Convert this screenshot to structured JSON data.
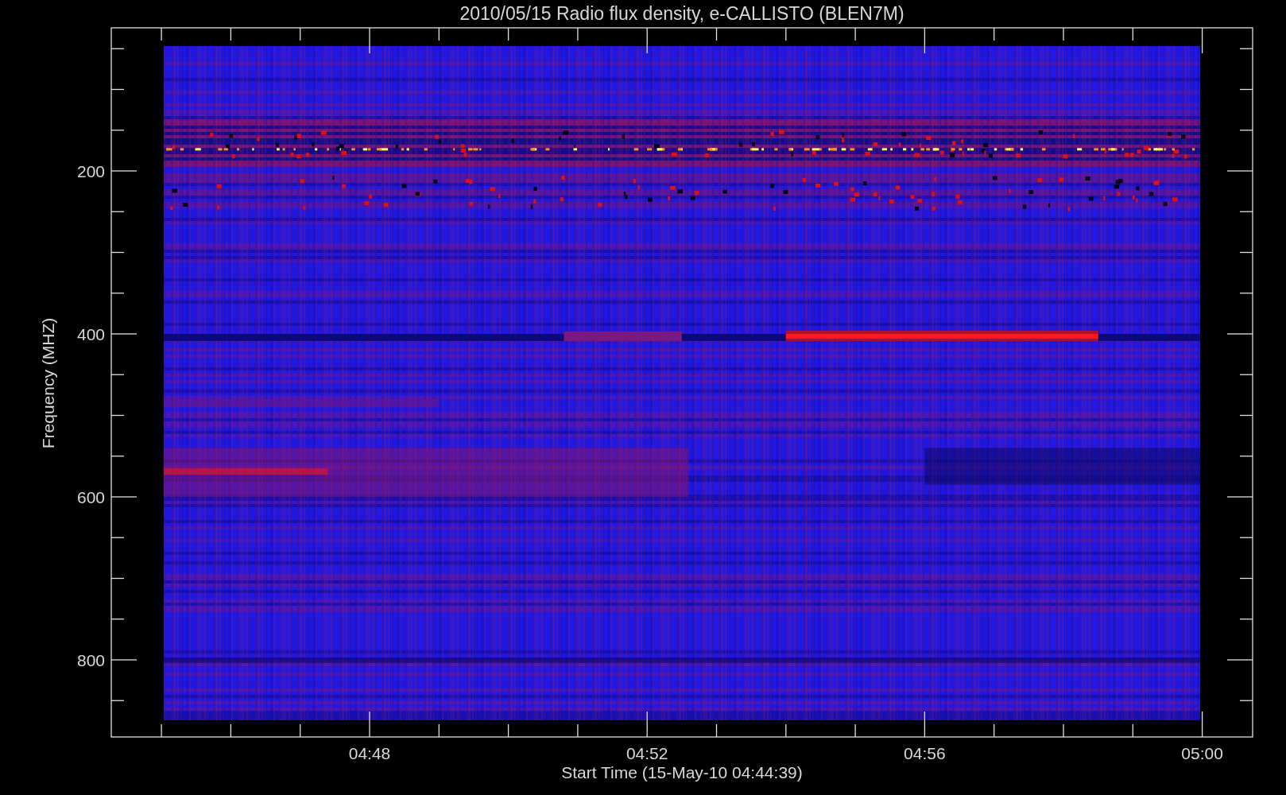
{
  "plot": {
    "title": "2010/05/15  Radio flux density, e-CALLISTO (BLEN7M)",
    "ylabel": "Frequency (MHZ)",
    "xlabel": "Start Time (15-May-10 04:44:39)",
    "y_tick_labels": [
      "200",
      "400",
      "600",
      "800"
    ],
    "x_tick_labels": [
      "04:48",
      "04:52",
      "04:56",
      "05:00"
    ]
  }
}
